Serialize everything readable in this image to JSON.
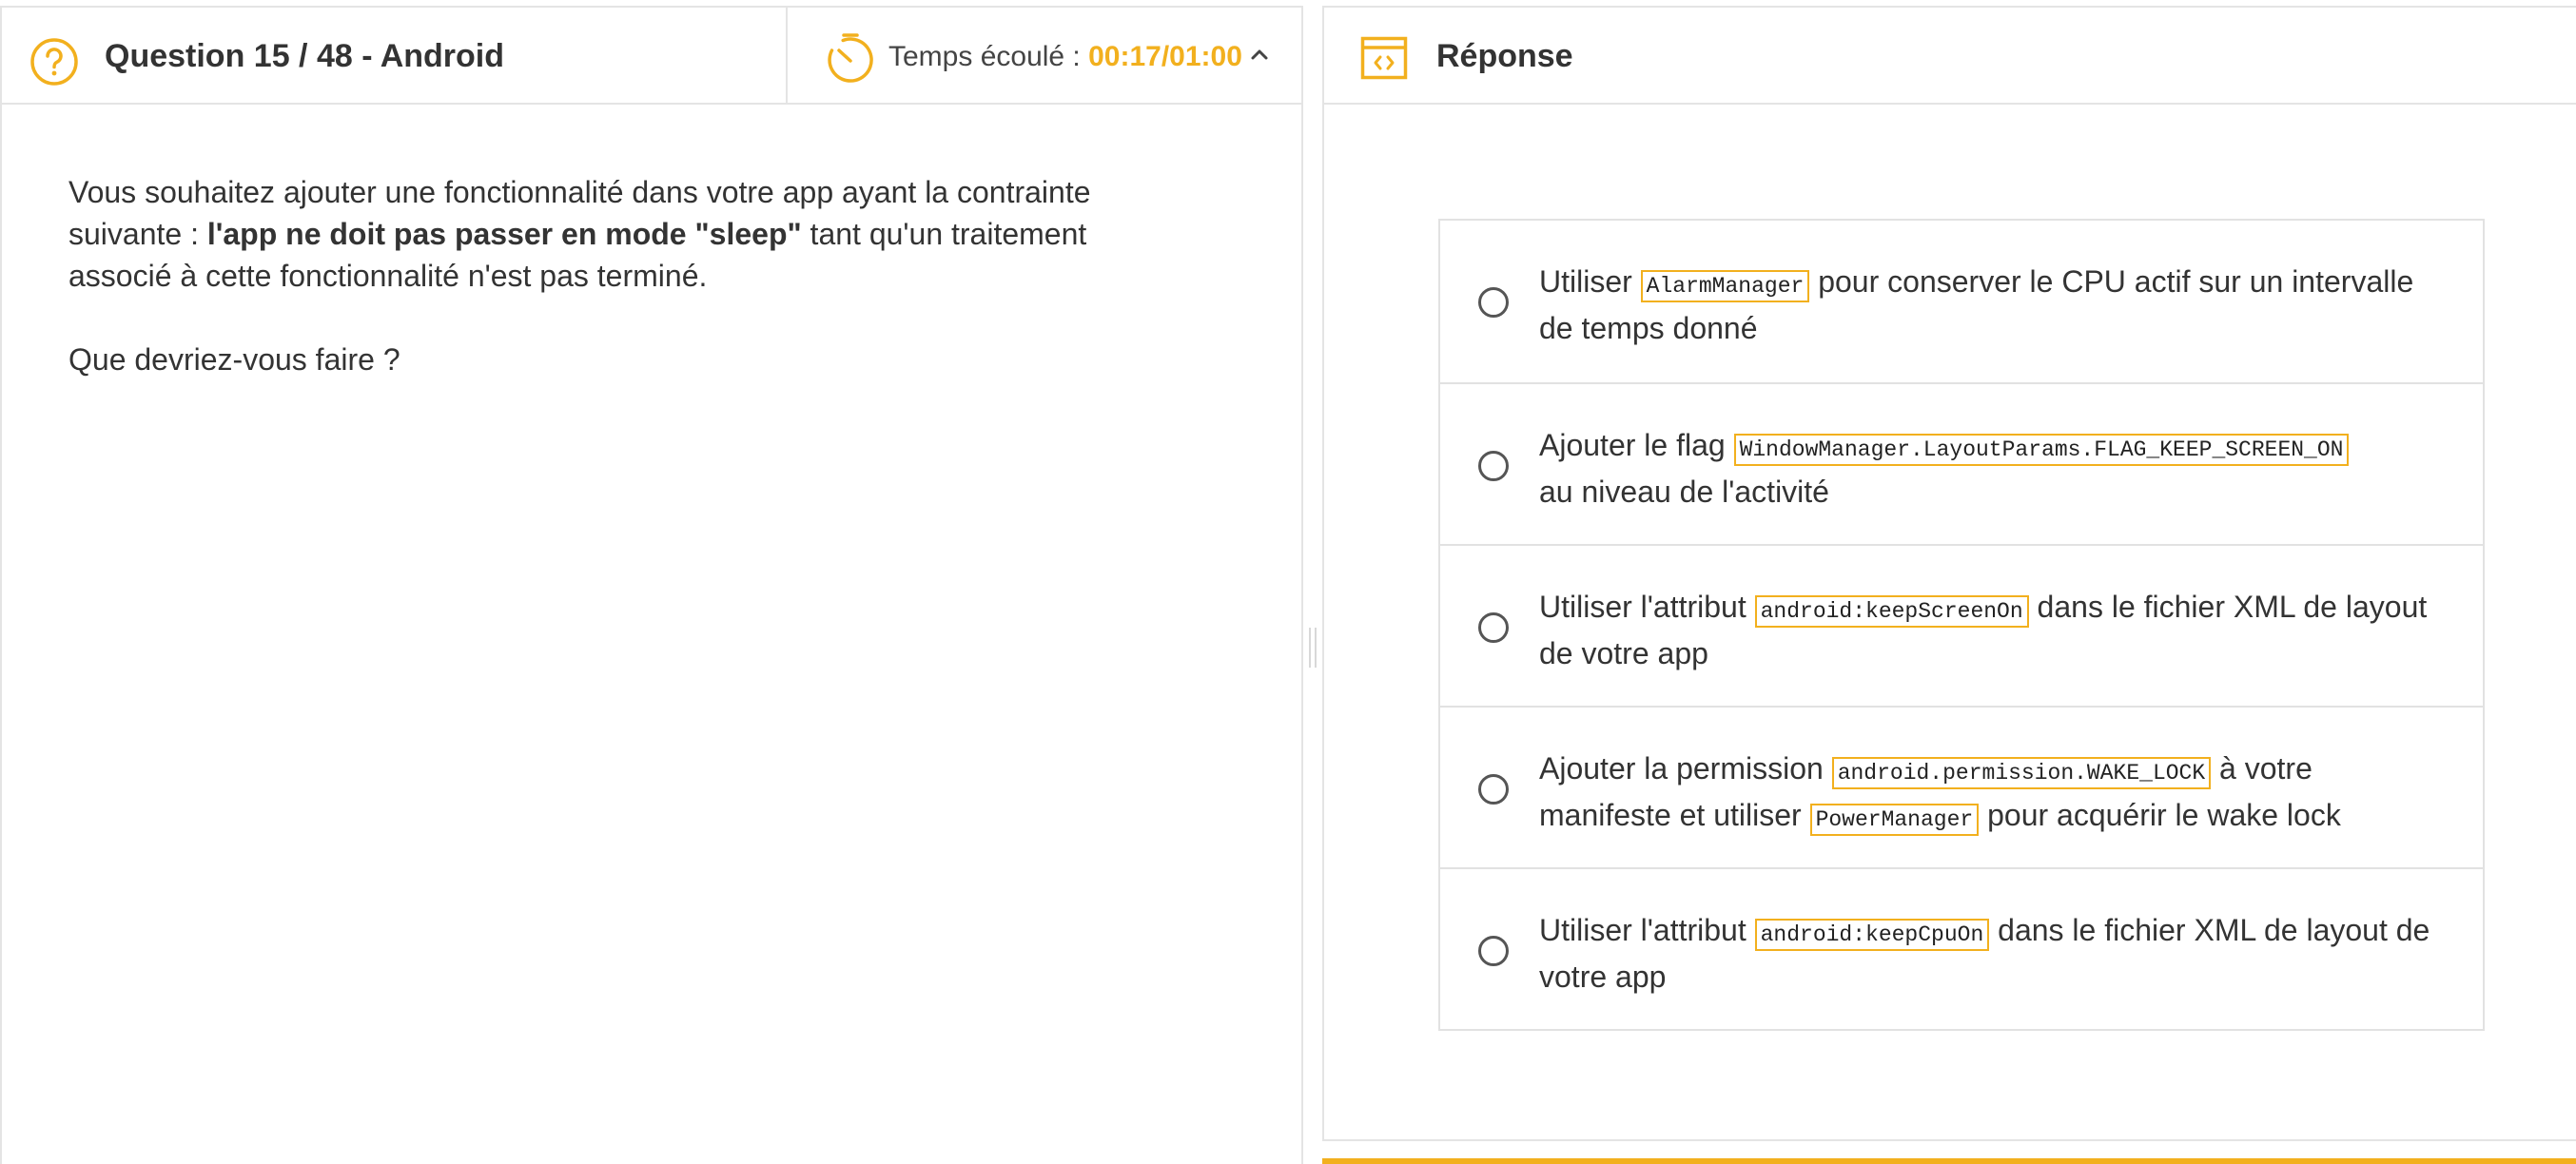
{
  "question_panel": {
    "title": "Question 15 / 48 - Android",
    "timer": {
      "label": "Temps écoulé : ",
      "value": "00:17/01:00"
    },
    "body": {
      "line_start": "Vous souhaitez ajouter une fonctionnalité dans votre app ayant la contrainte suivante : ",
      "bold_text": "l'app ne doit pas passer en mode \"sleep\"",
      "line_end": " tant qu'un traitement associé à cette fonctionnalité n'est pas terminé.",
      "prompt": "Que devriez-vous faire ?"
    }
  },
  "answer_panel": {
    "title": "Réponse",
    "options": [
      {
        "t1": "Utiliser ",
        "c1": "AlarmManager",
        "t2": " pour conserver le CPU actif sur un intervalle de temps donné",
        "c2": "",
        "t3": ""
      },
      {
        "t1": "Ajouter le flag ",
        "c1": "WindowManager.LayoutParams.FLAG_KEEP_SCREEN_ON",
        "t2": " au niveau de l'activité",
        "c2": "",
        "t3": ""
      },
      {
        "t1": "Utiliser l'attribut ",
        "c1": "android:keepScreenOn",
        "t2": " dans le fichier XML de layout de votre app",
        "c2": "",
        "t3": ""
      },
      {
        "t1": "Ajouter la permission ",
        "c1": "android.permission.WAKE_LOCK",
        "t2": " à votre manifeste et utiliser ",
        "c2": "PowerManager",
        "t3": " pour acquérir le wake lock"
      },
      {
        "t1": "Utiliser l'attribut ",
        "c1": "android:keepCpuOn",
        "t2": " dans le fichier XML de layout de votre app",
        "c2": "",
        "t3": ""
      }
    ]
  },
  "icons": {
    "help": "question-circle-icon",
    "timer": "stopwatch-icon",
    "collapse": "chevron-up-icon",
    "answer": "code-window-icon"
  },
  "colors": {
    "accent": "#f2b01e",
    "text": "#333333",
    "border": "#e4e4e4"
  }
}
